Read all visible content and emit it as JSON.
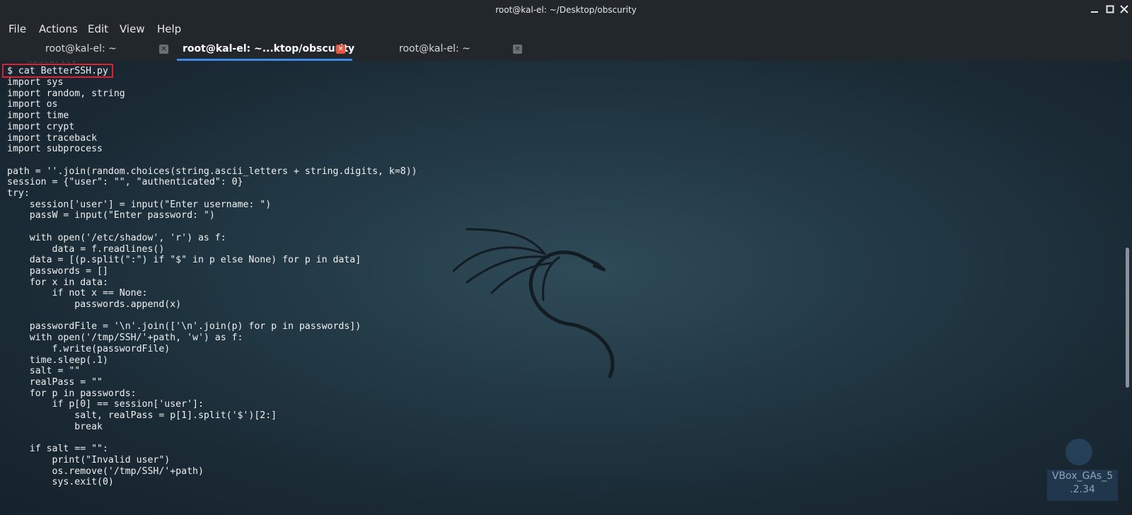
{
  "window": {
    "title": "root@kal-el: ~/Desktop/obscurity",
    "controls": [
      "minimize-icon",
      "maximize-icon",
      "close-icon"
    ]
  },
  "menu": [
    "File",
    "Actions",
    "Edit",
    "View",
    "Help"
  ],
  "tabs": [
    {
      "label": "root@kal-el: ~",
      "active": false
    },
    {
      "label": "root@kal-el: ~...ktop/obscurity",
      "active": true
    },
    {
      "label": "root@kal-el: ~",
      "active": false
    }
  ],
  "terminal": {
    "ghost_text": "obscurity",
    "prompt": "$ cat BetterSSH.py",
    "code_lines": [
      "import sys",
      "import random, string",
      "import os",
      "import time",
      "import crypt",
      "import traceback",
      "import subprocess",
      "",
      "path = ''.join(random.choices(string.ascii_letters + string.digits, k=8))",
      "session = {\"user\": \"\", \"authenticated\": 0}",
      "try:",
      "    session['user'] = input(\"Enter username: \")",
      "    passW = input(\"Enter password: \")",
      "",
      "    with open('/etc/shadow', 'r') as f:",
      "        data = f.readlines()",
      "    data = [(p.split(\":\") if \"$\" in p else None) for p in data]",
      "    passwords = []",
      "    for x in data:",
      "        if not x == None:",
      "            passwords.append(x)",
      "",
      "    passwordFile = '\\n'.join(['\\n'.join(p) for p in passwords])",
      "    with open('/tmp/SSH/'+path, 'w') as f:",
      "        f.write(passwordFile)",
      "    time.sleep(.1)",
      "    salt = \"\"",
      "    realPass = \"\"",
      "    for p in passwords:",
      "        if p[0] == session['user']:",
      "            salt, realPass = p[1].split('$')[2:]",
      "            break",
      "",
      "    if salt == \"\":",
      "        print(\"Invalid user\")",
      "        os.remove('/tmp/SSH/'+path)",
      "        sys.exit(0)"
    ]
  },
  "desktop": {
    "vbox_label_line1": "VBox_GAs_5",
    "vbox_label_line2": ".2.34"
  },
  "colors": {
    "highlight_box": "#e0202a",
    "active_tab_underline": "#3b8beb",
    "tab_close_active": "#e8533a"
  }
}
